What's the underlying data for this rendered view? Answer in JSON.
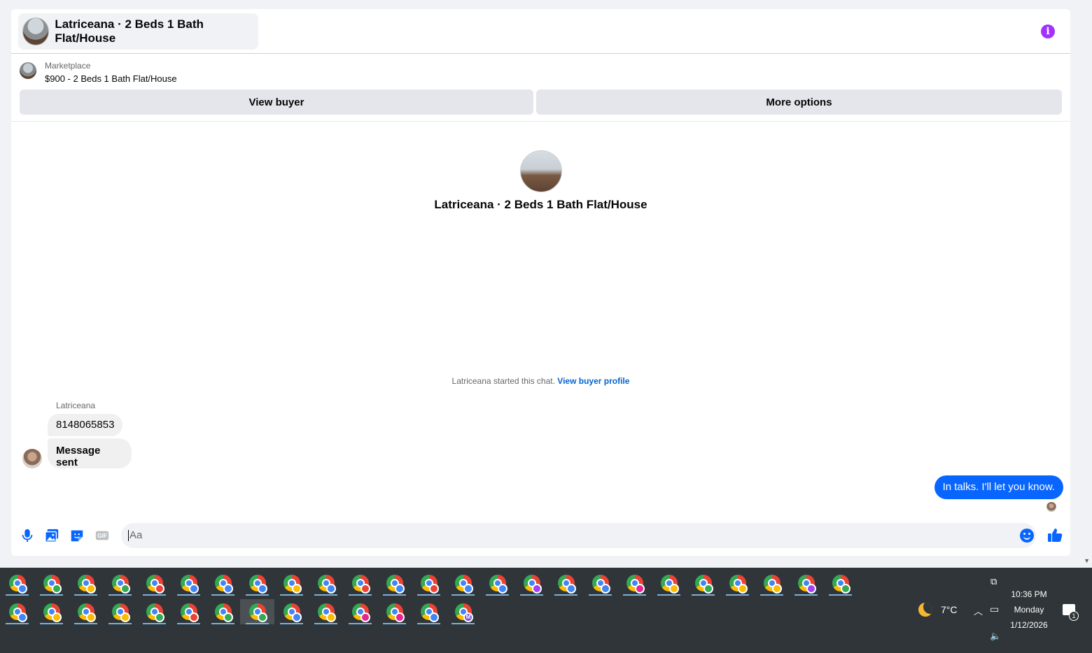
{
  "header": {
    "title": "Latriceana · 2 Beds 1 Bath Flat/House",
    "info_icon": "info-icon"
  },
  "listing": {
    "label": "Marketplace",
    "price_title": "$900 - 2 Beds 1 Bath Flat/House",
    "view_buyer_label": "View buyer",
    "more_options_label": "More options"
  },
  "conversation": {
    "title": "Latriceana · 2 Beds 1 Bath Flat/House",
    "started_text": "Latriceana started this chat.",
    "started_link": "View buyer profile",
    "sender_name": "Latriceana",
    "messages_in": [
      "8148065853",
      "Message sent"
    ],
    "message_out": "In talks. I'll let you know."
  },
  "composer": {
    "placeholder": "Aa",
    "tools": [
      "microphone-icon",
      "photo-icon",
      "sticker-icon",
      "gif-icon"
    ],
    "gif_label": "GIF",
    "accent": "#0866ff"
  },
  "taskbar": {
    "row1_badges": [
      "#4285f4",
      "#34a853",
      "#fbbc04",
      "#34a853",
      "#ea4335",
      "#4285f4",
      "#4285f4",
      "#4285f4",
      "#fbbc04",
      "#4285f4",
      "#ea4335",
      "#4285f4",
      "#ea4335",
      "#4285f4",
      "#4285f4",
      "#a142f4",
      "#4285f4",
      "#4285f4",
      "#e52592",
      "#fbbc04",
      "#34a853",
      "#fbbc04",
      "#fbbc04",
      "#a142f4",
      "#34a853"
    ],
    "row2_badges": [
      "#4285f4",
      "#fbbc04",
      "#fbbc04",
      "#fbbc04",
      "#34a853",
      "#ea4335",
      "#34a853",
      "#34a853",
      "#4285f4",
      "#fbbc04",
      "#e52592",
      "#e52592",
      "#4285f4",
      "#7b4fd6"
    ],
    "last_badge_letter": "M",
    "weather": "7°C",
    "time": "10:36 PM",
    "day": "Monday",
    "date": "1/12/2026",
    "notification_count": "1"
  }
}
